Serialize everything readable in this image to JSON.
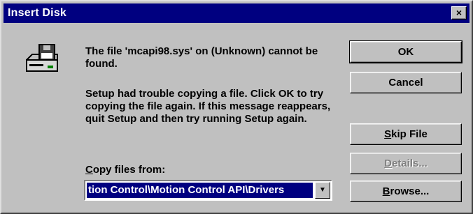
{
  "window": {
    "title": "Insert Disk",
    "close_glyph": "×"
  },
  "icon": {
    "name": "disk-drive-icon"
  },
  "message": {
    "line1": "The file 'mcapi98.sys' on (Unknown) cannot be found.",
    "line2": "Setup had trouble copying a file. Click OK to try copying the file again. If this message reappears, quit Setup and then try running Setup again."
  },
  "buttons": {
    "ok": "OK",
    "cancel": "Cancel",
    "skip_file_accel": "S",
    "skip_file_rest": "kip File",
    "details_accel": "D",
    "details_rest": "etails...",
    "browse_accel": "B",
    "browse_rest": "rowse..."
  },
  "copy_from": {
    "label_accel": "C",
    "label_rest": "opy files from:",
    "value": "tion Control\\Motion Control API\\Drivers",
    "dropdown_glyph": "▼"
  }
}
